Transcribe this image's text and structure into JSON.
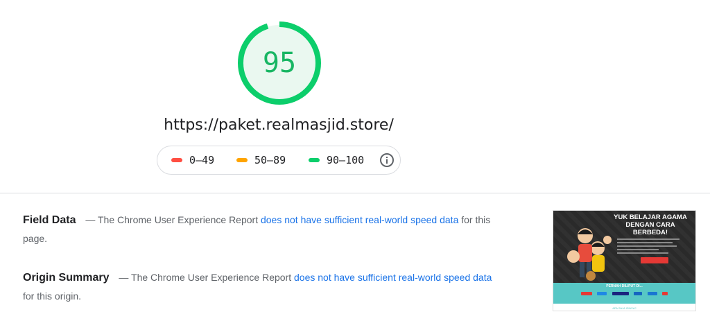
{
  "score": {
    "value": "95",
    "fraction": 0.95,
    "color": "#0cce6b",
    "bg_color": "#e8f8ef"
  },
  "url": "https://paket.realmasjid.store/",
  "legend": [
    {
      "label": "0–49",
      "color": "#ff4e42"
    },
    {
      "label": "50–89",
      "color": "#ffa400"
    },
    {
      "label": "90–100",
      "color": "#0cce6b"
    }
  ],
  "field_data": {
    "heading": "Field Data",
    "prefix": "— The Chrome User Experience Report",
    "link": "does not have sufficient real-world speed data",
    "suffix": "for this page."
  },
  "origin_summary": {
    "heading": "Origin Summary",
    "prefix": "— The Chrome User Experience Report",
    "link": "does not have sufficient real-world speed data",
    "suffix": "for this origin."
  },
  "screenshot": {
    "headline": "YUK BELAJAR AGAMA DENGAN CARA BERBEDA!",
    "band_text": "PERNAH DILIPUT DI...",
    "bottom_text": "APA SAJA ISINYA?",
    "icon": "website-screenshot-thumbnail"
  },
  "icons": {
    "info": "info-icon"
  }
}
